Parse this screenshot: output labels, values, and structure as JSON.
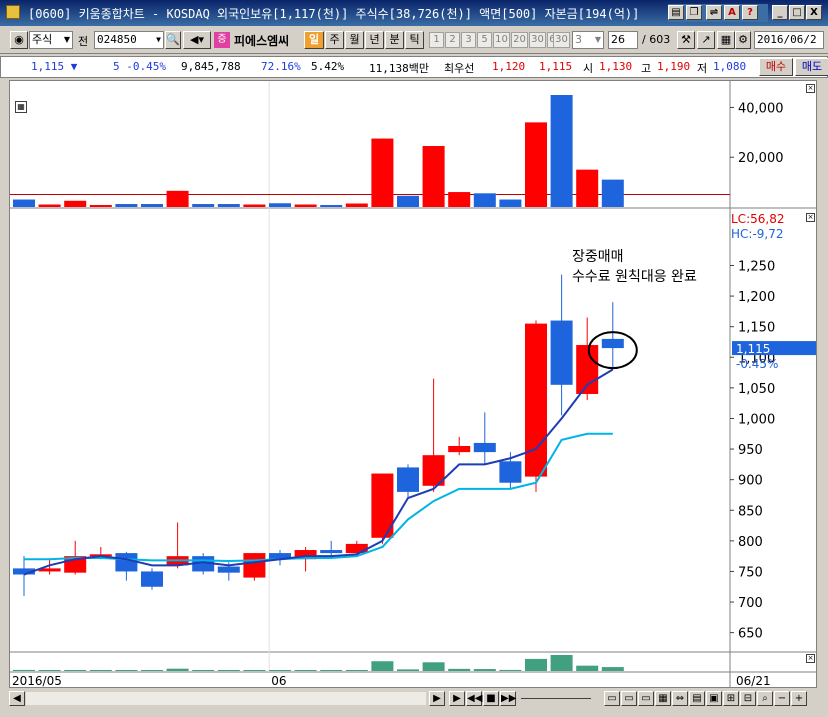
{
  "window": {
    "title": "[0600] 키움종합차트 - KOSDAQ 외국인보유[1,117(천)] 주식수[38,726(천)] 액면[500] 자본금[194(억)]",
    "controls": [
      "_",
      "□",
      "X"
    ]
  },
  "toolbar": {
    "market": "주식",
    "prev_label": "전",
    "code": "024850",
    "stock_name": "피에스엠씨",
    "day_label": "일",
    "periods": [
      "주",
      "월",
      "년",
      "분",
      "틱"
    ],
    "number_buttons": [
      "1",
      "2",
      "3",
      "5",
      "10",
      "20",
      "30",
      "60",
      "30",
      "3"
    ],
    "count": "26",
    "total": "/ 603",
    "date": "2016/06/2"
  },
  "quote": {
    "price": "1,115 ▼",
    "change": "5 -0.45%",
    "volume": "9,845,788",
    "vol_ratio": "72.16%",
    "turnover": "5.42%",
    "amount": "11,138백만",
    "best_label": "최우선",
    "ask": "1,120",
    "bid": "1,115",
    "open_label": "시",
    "open": "1,130",
    "high_label": "고",
    "high": "1,190",
    "low_label": "저",
    "low": "1,080",
    "buy_btn": "매수",
    "sell_btn": "매도"
  },
  "colors": {
    "up": "#ff0000",
    "down": "#1e64dc",
    "ma_short": "#1e3cb4",
    "ma_long": "#00b4e6",
    "volume_up": "#40a080"
  },
  "chart_data": {
    "type": "candlestick",
    "annotation": [
      "장중매매",
      "수수료 원칙대응 완료"
    ],
    "lc_label": "LC:56,82",
    "hc_label": "HC:-9,72",
    "current_price_label": "1,115",
    "current_change_label": "-0.45%",
    "x_labels": [
      {
        "index": 0,
        "label": "2016/05"
      },
      {
        "index": 10,
        "label": "06"
      },
      {
        "index": 29,
        "label": "06/21"
      }
    ],
    "price_ylim": [
      620,
      1290
    ],
    "price_ticks": [
      650,
      700,
      750,
      800,
      850,
      900,
      950,
      1000,
      1050,
      1100,
      1150,
      1200,
      1250
    ],
    "volume_ylim": [
      0,
      45000
    ],
    "volume_ticks": [
      20000,
      40000
    ],
    "volume_ref_line": 5000,
    "candles": [
      {
        "o": 755,
        "h": 775,
        "l": 710,
        "c": 745,
        "v": 3000
      },
      {
        "o": 750,
        "h": 770,
        "l": 745,
        "c": 755,
        "v": 1000
      },
      {
        "o": 748,
        "h": 800,
        "l": 745,
        "c": 775,
        "v": 2500
      },
      {
        "o": 775,
        "h": 790,
        "l": 770,
        "c": 778,
        "v": 800
      },
      {
        "o": 780,
        "h": 782,
        "l": 735,
        "c": 750,
        "v": 1200
      },
      {
        "o": 750,
        "h": 755,
        "l": 720,
        "c": 725,
        "v": 1200
      },
      {
        "o": 760,
        "h": 830,
        "l": 755,
        "c": 775,
        "v": 6500
      },
      {
        "o": 775,
        "h": 780,
        "l": 745,
        "c": 750,
        "v": 1200
      },
      {
        "o": 758,
        "h": 765,
        "l": 735,
        "c": 748,
        "v": 1200
      },
      {
        "o": 740,
        "h": 780,
        "l": 735,
        "c": 780,
        "v": 1000
      },
      {
        "o": 780,
        "h": 785,
        "l": 760,
        "c": 770,
        "v": 1500
      },
      {
        "o": 770,
        "h": 790,
        "l": 750,
        "c": 785,
        "v": 1000
      },
      {
        "o": 785,
        "h": 800,
        "l": 775,
        "c": 780,
        "v": 800
      },
      {
        "o": 780,
        "h": 800,
        "l": 775,
        "c": 795,
        "v": 1400
      },
      {
        "o": 805,
        "h": 880,
        "l": 795,
        "c": 910,
        "v": 27500
      },
      {
        "o": 920,
        "h": 925,
        "l": 870,
        "c": 880,
        "v": 4500
      },
      {
        "o": 890,
        "h": 1065,
        "l": 880,
        "c": 940,
        "v": 24500
      },
      {
        "o": 945,
        "h": 970,
        "l": 940,
        "c": 955,
        "v": 6000
      },
      {
        "o": 960,
        "h": 1010,
        "l": 925,
        "c": 945,
        "v": 5500
      },
      {
        "o": 930,
        "h": 945,
        "l": 885,
        "c": 895,
        "v": 3000
      },
      {
        "o": 905,
        "h": 1160,
        "l": 880,
        "c": 1155,
        "v": 34000
      },
      {
        "o": 1160,
        "h": 1235,
        "l": 1005,
        "c": 1055,
        "v": 45000
      },
      {
        "o": 1040,
        "h": 1165,
        "l": 1030,
        "c": 1120,
        "v": 15000
      },
      {
        "o": 1130,
        "h": 1190,
        "l": 1080,
        "c": 1115,
        "v": 11000
      }
    ],
    "ma_short": [
      745,
      760,
      770,
      775,
      770,
      760,
      760,
      765,
      760,
      765,
      770,
      775,
      775,
      778,
      800,
      870,
      885,
      925,
      925,
      935,
      950,
      1000,
      1055,
      1080
    ],
    "ma_long": [
      770,
      770,
      772,
      772,
      770,
      768,
      768,
      768,
      767,
      768,
      770,
      772,
      772,
      775,
      790,
      835,
      865,
      885,
      885,
      885,
      895,
      965,
      975,
      975
    ]
  },
  "bottom": {
    "nav_buttons": [
      "◀",
      "▶",
      "◀◀",
      "■",
      "▶▶"
    ],
    "zoom_out": "−",
    "zoom_in": "+",
    "scroll_left": "◀",
    "scroll_right": "▶"
  }
}
